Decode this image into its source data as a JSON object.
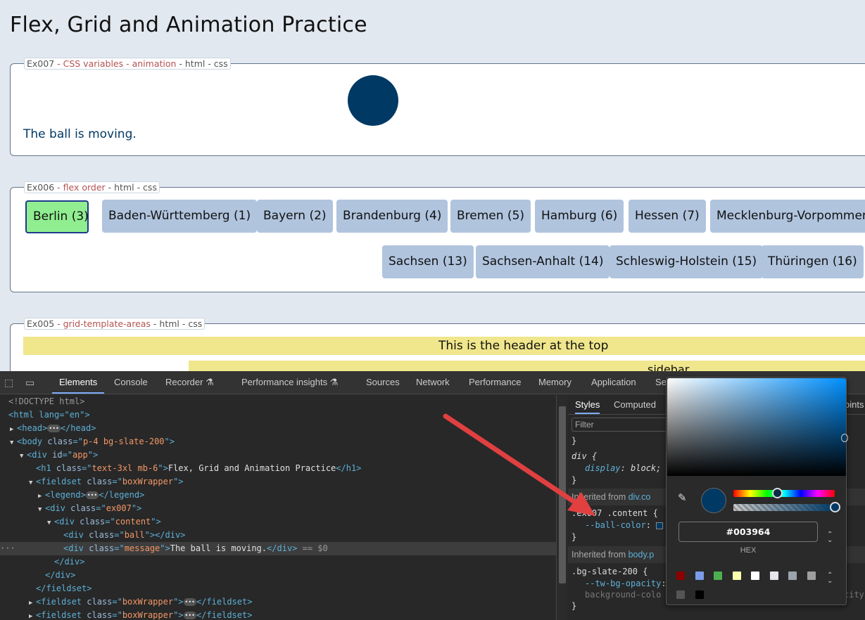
{
  "page": {
    "title": "Flex, Grid and Animation Practice",
    "ex007": {
      "legend_id": "Ex007",
      "legend_topic1": " - CSS variables - animation",
      "legend_rest": " - html - css",
      "message": "The ball is moving."
    },
    "ex006": {
      "legend_id": "Ex006",
      "legend_topic1": " - flex order",
      "legend_rest": " - html - css",
      "chips": [
        "Berlin (3)",
        "Baden-Württemberg (1)",
        "Bayern (2)",
        "Brandenburg (4)",
        "Bremen (5)",
        "Hamburg (6)",
        "Hessen (7)",
        "Mecklenburg-Vorpommern",
        "Sachsen (13)",
        "Sachsen-Anhalt (14)",
        "Schleswig-Holstein (15)",
        "Thüringen (16)"
      ]
    },
    "ex005": {
      "legend_id": "Ex005",
      "legend_topic1": " - grid-template-areas",
      "legend_rest": " - html - css",
      "header_text": "This is the header at the top",
      "sidebar_text": "sidebar"
    }
  },
  "devtools": {
    "tabs": [
      "Elements",
      "Console",
      "Recorder",
      "Performance insights",
      "Sources",
      "Network",
      "Performance",
      "Memory",
      "Application",
      "Se"
    ],
    "dom": {
      "doctype": "<!DOCTYPE html>",
      "html_open": "<html lang=\"en\">",
      "head": "head",
      "body_class": "p-4 bg-slate-200",
      "app_id": "app",
      "h1_class": "text-3xl mb-6",
      "h1_text": "Flex, Grid and Animation Practice",
      "fieldset_class": "boxWrapper",
      "ex007_class": "ex007",
      "content_class": "content",
      "ball_class": "ball",
      "message_class": "message",
      "message_text": "The ball is moving.",
      "selected_suffix": " == $0"
    },
    "styles": {
      "tabs": [
        "Styles",
        "Computed",
        "oints"
      ],
      "filter_placeholder": "Filter",
      "div_rule_selector": "div {",
      "div_rule_prop": "display",
      "div_rule_value": "block;",
      "inherited1_label": "Inherited from ",
      "inherited1_link": "div.co",
      "rule2_selector": ".ex007 .content {",
      "rule2_prop": "--ball-color",
      "inherited2_label": "Inherited from ",
      "inherited2_link": "body.p",
      "rule3_selector": ".bg-slate-200 {",
      "rule3_prop1": "--tw-bg-opacity",
      "rule3_prop2": "background-colo",
      "rule3_tail": "city"
    },
    "color_picker": {
      "hex_value": "#003964",
      "format_label": "HEX",
      "current_color": "#003964",
      "swatches": [
        "#8b0000",
        "#7b9ce8",
        "#4caf50",
        "#ffffb0",
        "#ffffff",
        "#e5e7eb",
        "#9ca3af",
        "#9e9e9e",
        "#555555",
        "#000000"
      ]
    }
  }
}
